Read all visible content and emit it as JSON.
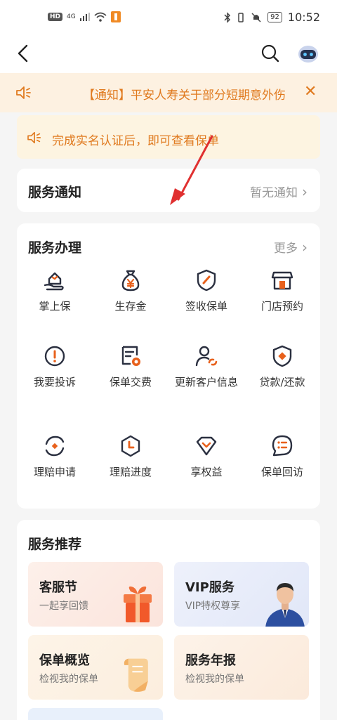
{
  "status_bar": {
    "hd": "HD",
    "network": "4G",
    "battery": "92",
    "time": "10:52"
  },
  "notice": {
    "text": "【通知】平安人寿关于部分短期意外伤",
    "close": "✕"
  },
  "auth_banner": {
    "text": "完成实名认证后，即可查看保单"
  },
  "service_notice": {
    "title": "服务通知",
    "right": "暂无通知",
    "chevron": "›"
  },
  "service_handle": {
    "title": "服务办理",
    "more": "更多",
    "chevron": "›",
    "items": [
      {
        "label": "掌上保",
        "icon": "hand-house-icon"
      },
      {
        "label": "生存金",
        "icon": "money-bag-icon"
      },
      {
        "label": "签收保单",
        "icon": "shield-pen-icon"
      },
      {
        "label": "门店预约",
        "icon": "store-icon"
      },
      {
        "label": "我要投诉",
        "icon": "alert-circle-icon"
      },
      {
        "label": "保单交费",
        "icon": "policy-pay-icon"
      },
      {
        "label": "更新客户信息",
        "icon": "user-refresh-icon"
      },
      {
        "label": "贷款/还款",
        "icon": "shield-diamond-icon"
      },
      {
        "label": "理赔申请",
        "icon": "claim-refresh-icon"
      },
      {
        "label": "理赔进度",
        "icon": "clock-hexagon-icon"
      },
      {
        "label": "享权益",
        "icon": "diamond-icon"
      },
      {
        "label": "保单回访",
        "icon": "chat-list-icon"
      }
    ]
  },
  "service_recommend": {
    "title": "服务推荐",
    "cards": [
      {
        "title": "客服节",
        "subtitle": "一起享回馈",
        "icon": "gift-box-icon"
      },
      {
        "title": "VIP服务",
        "subtitle": "VIP特权尊享",
        "icon": "agent-portrait"
      },
      {
        "title": "保单概览",
        "subtitle": "检视我的保单",
        "icon": "document-scroll-icon"
      },
      {
        "title": "服务年报",
        "subtitle": "检视我的保单",
        "icon": ""
      }
    ]
  },
  "colors": {
    "accent": "#e8611c",
    "notice_bg": "#fdf1e1",
    "icon_dark": "#2b3040",
    "annotation_arrow": "#e03030"
  }
}
